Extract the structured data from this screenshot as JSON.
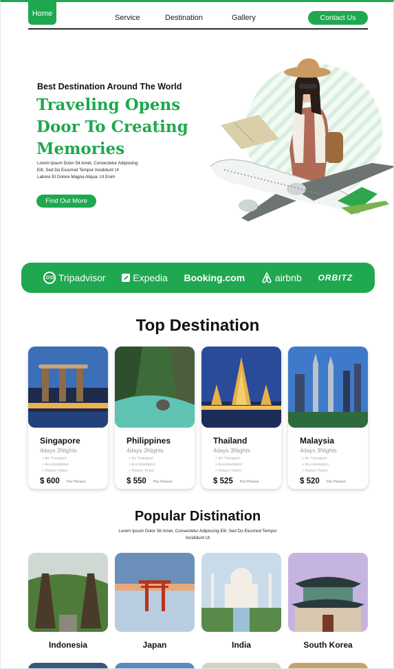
{
  "nav": {
    "home": "Home",
    "links": [
      "Service",
      "Destination",
      "Gallery"
    ],
    "contact": "Contact Us"
  },
  "hero": {
    "subtitle": "Best Destination Around The World",
    "title_line1": "Traveling Opens",
    "title_line2": "Door To Creating",
    "title_line3": "Memories",
    "text_line1": "Lorem Ipsum Dolor Sit Amet, Consectetur Adipiscing",
    "text_line2": "Elit, Sed Do Eiusmod Tempor Incididunt Ut",
    "text_line3": "Labore Et Dolore Magna Aliqua. Ut Enim",
    "button": "Find Out More"
  },
  "partners": [
    "Tripadvisor",
    "Expedia",
    "Booking.com",
    "airbnb",
    "ORBITZ"
  ],
  "top_destination": {
    "title": "Top Destination",
    "cards": [
      {
        "name": "Singapore",
        "days": "4days 3Nights",
        "price": "$ 600"
      },
      {
        "name": "Philippines",
        "days": "4days 3Nights",
        "price": "$ 550"
      },
      {
        "name": "Thailand",
        "days": "4days 3Nights",
        "price": "$ 525"
      },
      {
        "name": "Malaysia",
        "days": "4days 3Nights",
        "price": "$ 520"
      }
    ],
    "features": [
      "Air Transport",
      "Accomodation",
      "Return Ticket"
    ],
    "per_person": "Per Person"
  },
  "popular": {
    "title": "Popular Distination",
    "text_line1": "Lorem Ipsum Dolor Sit Amet, Consectetur Adipiscing Elit, Sed Do Eiusmod Tempor",
    "text_line2": "Incididunt Ut",
    "items": [
      "Indonesia",
      "Japan",
      "India",
      "South Korea"
    ]
  },
  "colors": {
    "accent": "#1fa84f",
    "text": "#111111"
  }
}
